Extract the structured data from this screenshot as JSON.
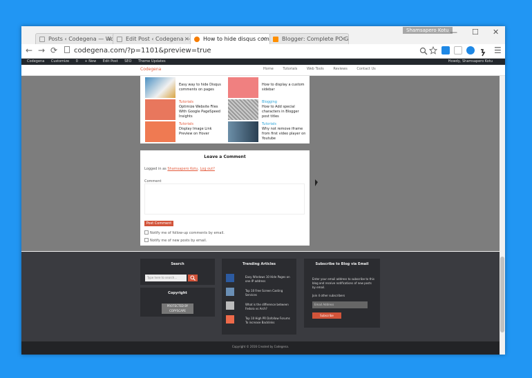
{
  "browser": {
    "tabs": [
      {
        "label": "Posts ‹ Codegena — Wor"
      },
      {
        "label": "Edit Post ‹ Codegena — W"
      },
      {
        "label": "How to hide disqus comm"
      },
      {
        "label": "Blogger: Complete PC Gu"
      }
    ],
    "tab_close": "×",
    "user_badge": "Shamsapero Kotu",
    "window_controls": {
      "minimize": "—",
      "maximize": "☐",
      "close": "✕"
    },
    "nav": {
      "back": "←",
      "forward": "→",
      "reload": "⟳"
    },
    "url": "codegena.com/?p=1101&preview=true",
    "menu": "☰"
  },
  "adminbar": {
    "items": [
      "Codegena",
      "Customize",
      "0",
      "+ New",
      "Edit Post",
      "SEO",
      "Theme Updates"
    ],
    "howdy": "Howdy, Shamsapero Kotu"
  },
  "site": {
    "brand": "Codegena",
    "nav": [
      "Home",
      "Tutorials",
      "Web Tools",
      "Reviews",
      "Contact Us"
    ]
  },
  "related": [
    {
      "cat": "",
      "title": "Easy way to hide Disqus comments on pages"
    },
    {
      "cat": "",
      "title": "How to display a custom sidebar"
    },
    {
      "cat": "Tutorials",
      "title": "Optimize Website Files With Google PageSpeed Insights"
    },
    {
      "cat": "Blogging",
      "title": "How to Add special characters in Blogger post titles"
    },
    {
      "cat": "Tutorials",
      "title": "Display Image Link Preview on Hover"
    },
    {
      "cat": "Tutorials",
      "title": "Why not remove iframe from first video player on Youtube"
    }
  ],
  "comment": {
    "heading": "Leave a Comment",
    "logged_prefix": "Logged in as",
    "user": "Shamsapero Kotu",
    "logout": "Log out?",
    "label": "Comment",
    "post_button": "Post Comment",
    "notify_followup": "Notify me of follow-up comments by email.",
    "notify_posts": "Notify me of new posts by email."
  },
  "footer": {
    "search_title": "Search",
    "search_placeholder": "Type here to search...",
    "search_icon": "🔍",
    "copyright_title": "Copyright",
    "dmca": "PROTECTED BY COPYSCAPE",
    "trending_title": "Trending Articles",
    "trending": [
      {
        "title": "Easy Windows 10 Hide Pages on one IP address"
      },
      {
        "title": "Top 10 Free Screen Casting Services"
      },
      {
        "title": "What is the difference between Fedora vs Arch?"
      },
      {
        "title": "Top 10 High PR Dofollow Forums To increase Backlinks"
      }
    ],
    "subscribe_title": "Subscribe to Blog via Email",
    "subscribe_text": "Enter your email address to subscribe to this blog and receive notifications of new posts by email.",
    "subscribers": "Join 4 other subscribers",
    "email_placeholder": "Email Address",
    "subscribe_button": "Subscribe",
    "copyright_bar": "Copyright © 2016 Created by Codegena."
  },
  "colors": {
    "accent": "#d2543a",
    "desktop": "#2196f3"
  }
}
